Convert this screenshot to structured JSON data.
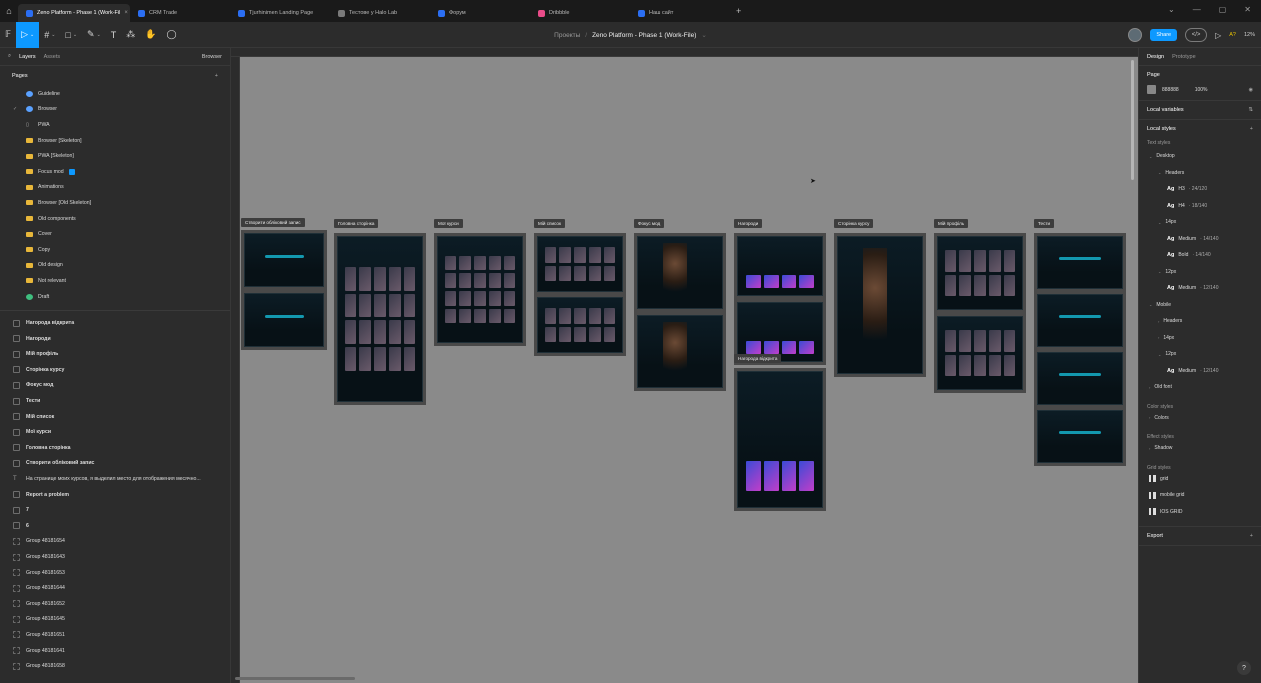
{
  "browser": {
    "tabs": [
      {
        "label": "Zeno Platform - Phase 1 (Work-Fil",
        "active": true,
        "fav": "blue"
      },
      {
        "label": "CRM Trade",
        "active": false,
        "fav": "blue"
      },
      {
        "label": "Tjurhinimen Landing Page",
        "active": false,
        "fav": "blue"
      },
      {
        "label": "Тестове у Halo Lab",
        "active": false,
        "fav": "grey"
      },
      {
        "label": "Форум",
        "active": false,
        "fav": "blue"
      },
      {
        "label": "Dribbble",
        "active": false,
        "fav": "pink"
      },
      {
        "label": "Наш сайт",
        "active": false,
        "fav": "blue"
      }
    ],
    "close_glyph": "×",
    "new_tab": "+",
    "window_controls": [
      "⌄",
      "—",
      "▢",
      "✕"
    ]
  },
  "toolbar": {
    "tools": [
      {
        "icon": "main-menu-icon",
        "glyph": "𝔽",
        "active": false
      },
      {
        "icon": "move-tool-icon",
        "glyph": "▷",
        "active": true
      },
      {
        "icon": "frame-tool-icon",
        "glyph": "#",
        "active": false
      },
      {
        "icon": "shape-tool-icon",
        "glyph": "□",
        "active": false
      },
      {
        "icon": "pen-tool-icon",
        "glyph": "✎",
        "active": false
      },
      {
        "icon": "text-tool-icon",
        "glyph": "T",
        "active": false
      },
      {
        "icon": "resources-icon",
        "glyph": "⁂",
        "active": false
      },
      {
        "icon": "hand-tool-icon",
        "glyph": "✋",
        "active": false
      },
      {
        "icon": "comment-tool-icon",
        "glyph": "◯",
        "active": false
      }
    ],
    "breadcrumb_project": "Проекты",
    "breadcrumb_sep": "/",
    "file_name": "Zeno Platform - Phase 1 (Work-File)",
    "share_label": "Share",
    "code_label": "</>",
    "aa_label": "A?",
    "zoom_label": "12%"
  },
  "left_panel": {
    "tab_layers": "Layers",
    "tab_assets": "Assets",
    "browser_label": "Browser",
    "pages_title": "Pages",
    "pages": [
      {
        "label": "Guideline",
        "icon": "blue",
        "check": ""
      },
      {
        "label": "Browser",
        "icon": "blue",
        "check": "✓"
      },
      {
        "label": "PWA",
        "icon": "none",
        "check": ""
      },
      {
        "label": "Browser [Skeleton]",
        "icon": "folder",
        "check": ""
      },
      {
        "label": "PWA [Skeleton]",
        "icon": "folder",
        "check": ""
      },
      {
        "label": "Focus mod",
        "icon": "folder",
        "check": "",
        "badge": true
      },
      {
        "label": "Animations",
        "icon": "folder",
        "check": ""
      },
      {
        "label": "Browser [Old Skeleton]",
        "icon": "folder",
        "check": ""
      },
      {
        "label": "Old components",
        "icon": "folder",
        "check": ""
      },
      {
        "label": "Cover",
        "icon": "folder",
        "check": ""
      },
      {
        "label": "Copy",
        "icon": "folder",
        "check": ""
      },
      {
        "label": "Old design",
        "icon": "folder",
        "check": ""
      },
      {
        "label": "Not relevant",
        "icon": "folder",
        "check": ""
      },
      {
        "label": "Draft",
        "icon": "green",
        "check": ""
      }
    ],
    "layers": [
      {
        "label": "Нагорода відкрита",
        "bold": true,
        "kind": "frame"
      },
      {
        "label": "Нагороди",
        "bold": true,
        "kind": "frame"
      },
      {
        "label": "Мій профіль",
        "bold": true,
        "kind": "frame"
      },
      {
        "label": "Сторінка курсу",
        "bold": true,
        "kind": "frame"
      },
      {
        "label": "Фокус мод",
        "bold": true,
        "kind": "frame"
      },
      {
        "label": "Тести",
        "bold": true,
        "kind": "frame"
      },
      {
        "label": "Мій список",
        "bold": true,
        "kind": "frame"
      },
      {
        "label": "Мої курси",
        "bold": true,
        "kind": "frame"
      },
      {
        "label": "Головна сторінка",
        "bold": true,
        "kind": "frame"
      },
      {
        "label": "Створити обліковий запис",
        "bold": true,
        "kind": "frame"
      },
      {
        "label": "На странице моих курсов, я выделил место для отображения месячно...",
        "bold": false,
        "kind": "text"
      },
      {
        "label": "Report a problem",
        "bold": true,
        "kind": "frame"
      },
      {
        "label": "7",
        "bold": true,
        "kind": "frame"
      },
      {
        "label": "6",
        "bold": true,
        "kind": "frame"
      },
      {
        "label": "Group 48181654",
        "bold": false,
        "kind": "group"
      },
      {
        "label": "Group 48181643",
        "bold": false,
        "kind": "group"
      },
      {
        "label": "Group 48181653",
        "bold": false,
        "kind": "group"
      },
      {
        "label": "Group 48181644",
        "bold": false,
        "kind": "group"
      },
      {
        "label": "Group 48181652",
        "bold": false,
        "kind": "group"
      },
      {
        "label": "Group 48181645",
        "bold": false,
        "kind": "group"
      },
      {
        "label": "Group 48181651",
        "bold": false,
        "kind": "group"
      },
      {
        "label": "Group 48181641",
        "bold": false,
        "kind": "group"
      },
      {
        "label": "Group 48181658",
        "bold": false,
        "kind": "group"
      }
    ]
  },
  "canvas": {
    "frames": [
      {
        "label": "Створити обліковий запис",
        "screens": 2,
        "style": "form"
      },
      {
        "label": "Головна сторінка",
        "screens": 1,
        "style": "thumbs"
      },
      {
        "label": "Мої курси",
        "screens": 1,
        "style": "thumbs"
      },
      {
        "label": "Мій список",
        "screens": 2,
        "style": "thumbs"
      },
      {
        "label": "Фокус мод",
        "screens": 2,
        "style": "photo"
      },
      {
        "label": "Нагороди",
        "screens": 2,
        "style": "cards"
      },
      {
        "label": "Сторінка курсу",
        "screens": 1,
        "style": "photo"
      },
      {
        "label": "Мій профіль",
        "screens": 2,
        "style": "thumbs"
      },
      {
        "label": "Тести",
        "screens": 4,
        "style": "form"
      },
      {
        "label": "Нагорода відкрита",
        "screens": 1,
        "style": "cards"
      }
    ]
  },
  "right_panel": {
    "tab_design": "Design",
    "tab_prototype": "Prototype",
    "page_title": "Page",
    "page_color": "888888",
    "page_opacity": "100%",
    "local_variables": "Local variables",
    "local_styles": "Local styles",
    "text_styles": "Text styles",
    "text_tree": [
      {
        "label": "Desktop",
        "depth": 1,
        "caret": "⌄"
      },
      {
        "label": "Headers",
        "depth": 2,
        "caret": "⌄"
      },
      {
        "ag": "Ag",
        "label": "H3",
        "meta": "· 24/120",
        "depth": 3
      },
      {
        "ag": "Ag",
        "label": "H4",
        "meta": "· 18/140",
        "depth": 3
      },
      {
        "label": "14px",
        "depth": 2,
        "caret": "⌄"
      },
      {
        "ag": "Ag",
        "label": "Medium",
        "meta": "· 14/140",
        "depth": 3
      },
      {
        "ag": "Ag",
        "label": "Bold",
        "meta": "· 14/140",
        "depth": 3
      },
      {
        "label": "12px",
        "depth": 2,
        "caret": "⌄"
      },
      {
        "ag": "Ag",
        "label": "Medium",
        "meta": "· 12/140",
        "depth": 3
      },
      {
        "label": "Mobile",
        "depth": 1,
        "caret": "⌄"
      },
      {
        "label": "Headers",
        "depth": 2,
        "caret": "›"
      },
      {
        "label": "14px",
        "depth": 2,
        "caret": "›"
      },
      {
        "label": "12px",
        "depth": 2,
        "caret": "⌄"
      },
      {
        "ag": "Ag",
        "label": "Medium",
        "meta": "· 12/140",
        "depth": 3
      },
      {
        "label": "Old font",
        "depth": 1,
        "caret": "›"
      }
    ],
    "color_styles": "Color styles",
    "colors": "Colors",
    "effect_styles": "Effect styles",
    "shadow": "Shadow",
    "grid_styles": "Grid styles",
    "grids": [
      "grid",
      "mobile grid",
      "IOS GRID"
    ],
    "export": "Export",
    "help": "?"
  },
  "colors": {
    "accent": "#0d99ff",
    "canvas": "#8a8a8a",
    "panel": "#2c2c2c",
    "teal": "#17b9d4"
  }
}
